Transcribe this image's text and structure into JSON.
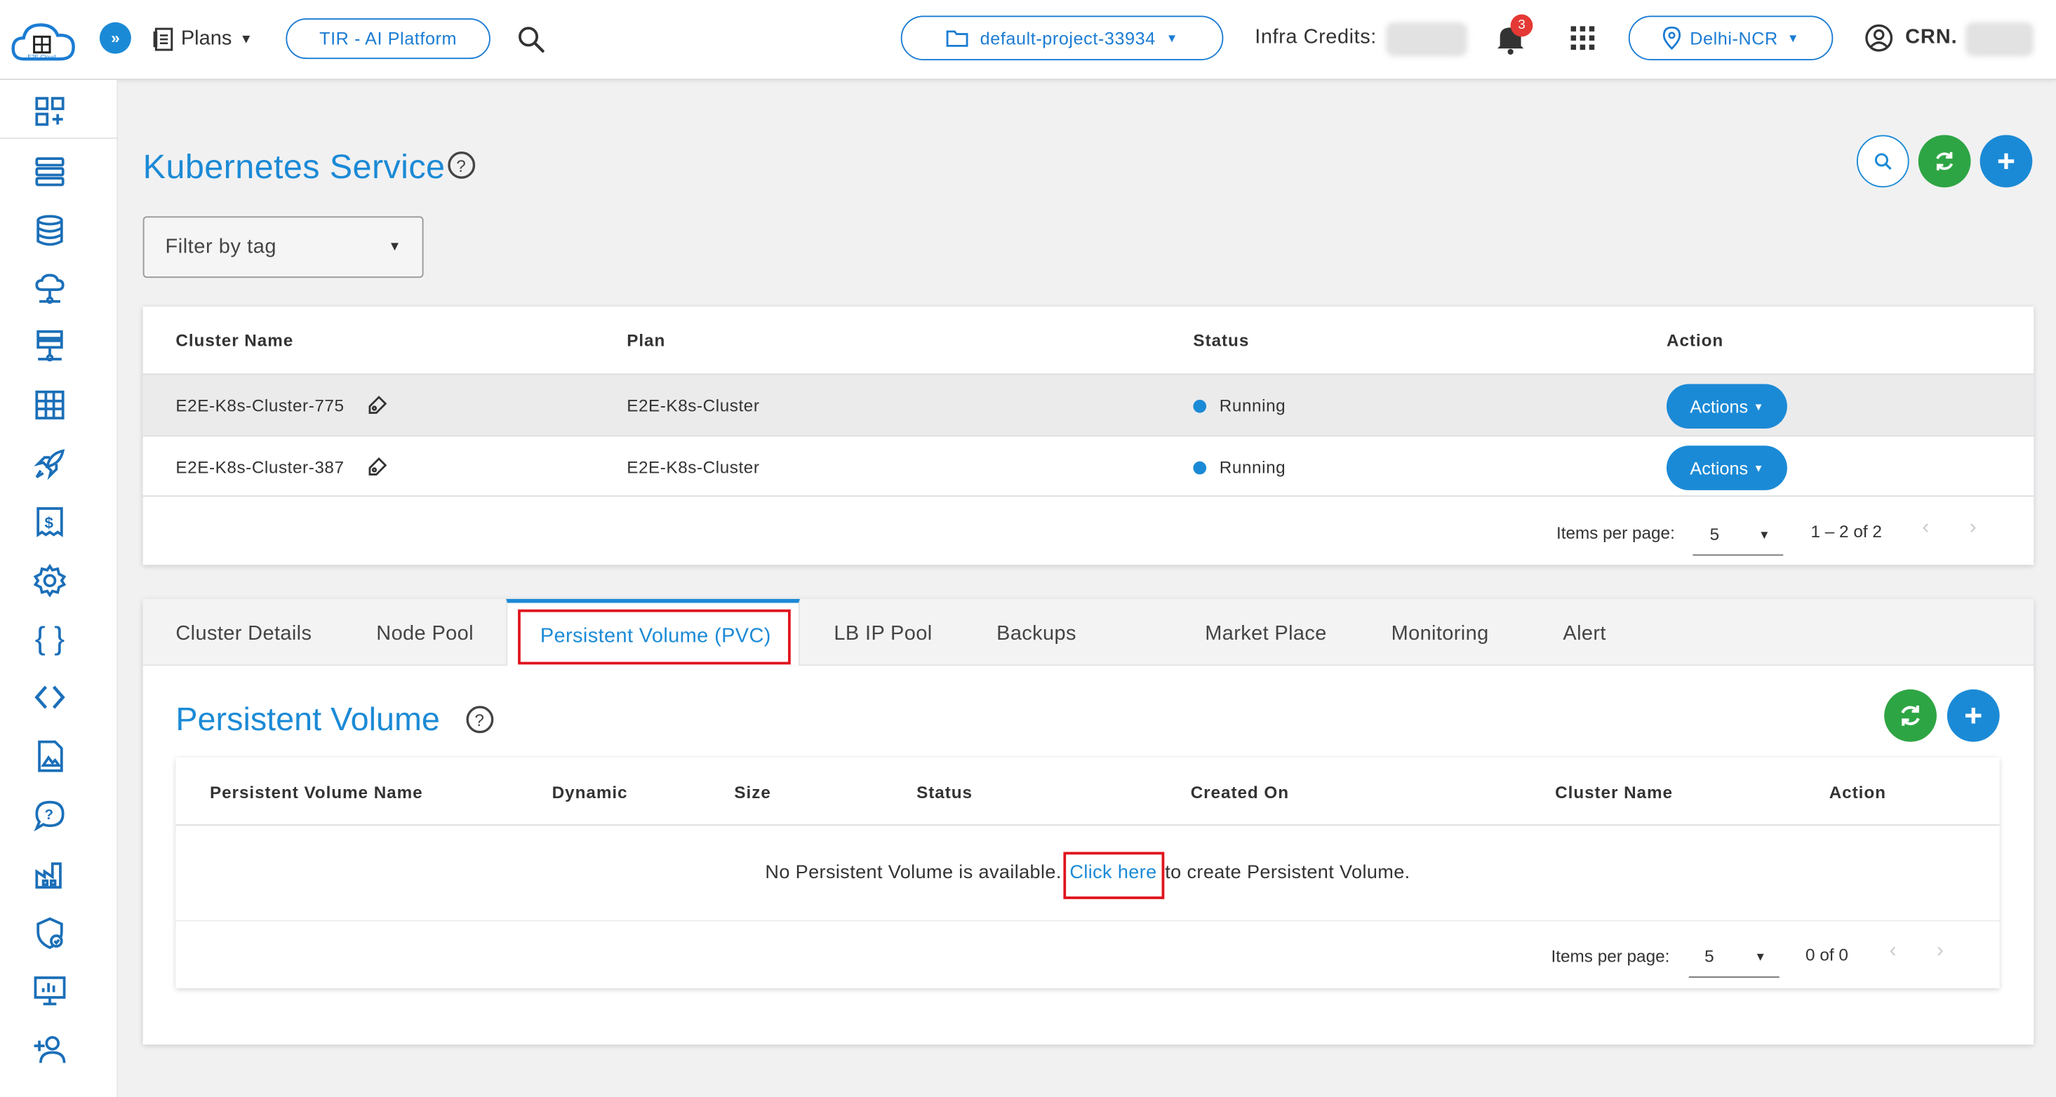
{
  "topbar": {
    "logo_text": "E2E Cloud",
    "plans_label": "Plans",
    "tir_label": "TIR - AI Platform",
    "project_label": "default-project-33934",
    "infra_credits_label": "Infra Credits:",
    "notification_count": "3",
    "region_label": "Delhi-NCR",
    "crn_label": "CRN."
  },
  "page": {
    "title": "Kubernetes Service",
    "filter_placeholder": "Filter by tag"
  },
  "clusters_table": {
    "columns": [
      "Cluster Name",
      "Plan",
      "Status",
      "Action"
    ],
    "rows": [
      {
        "name": "E2E-K8s-Cluster-775",
        "plan": "E2E-K8s-Cluster",
        "status": "Running",
        "action": "Actions"
      },
      {
        "name": "E2E-K8s-Cluster-387",
        "plan": "E2E-K8s-Cluster",
        "status": "Running",
        "action": "Actions"
      }
    ],
    "items_per_page_label": "Items per page:",
    "items_per_page": "5",
    "range": "1 – 2 of 2"
  },
  "tabs": [
    "Cluster Details",
    "Node Pool",
    "Persistent Volume (PVC)",
    "LB IP Pool",
    "Backups",
    "Market Place",
    "Monitoring",
    "Alert"
  ],
  "pv": {
    "title": "Persistent Volume",
    "columns": [
      "Persistent Volume Name",
      "Dynamic",
      "Size",
      "Status",
      "Created On",
      "Cluster Name",
      "Action"
    ],
    "empty_prefix": "No Persistent Volume is available.",
    "empty_link": "Click here",
    "empty_suffix": "to create Persistent Volume.",
    "items_per_page_label": "Items per page:",
    "items_per_page": "5",
    "range": "0 of 0"
  },
  "colors": {
    "accent": "#1b8ad6",
    "title": "#1b8ad6",
    "green": "#2ea544",
    "running_dot": "#1b8ad6",
    "highlight": "#e0131d"
  }
}
